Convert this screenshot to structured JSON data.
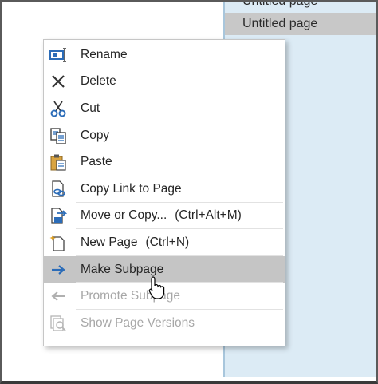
{
  "pages": {
    "items": [
      {
        "label": "Untitled page"
      },
      {
        "label": "Untitled page",
        "selected": true
      }
    ]
  },
  "context_menu": {
    "items": [
      {
        "label": "Rename",
        "icon": "rename-icon",
        "enabled": true
      },
      {
        "label": "Delete",
        "icon": "delete-icon",
        "enabled": true
      },
      {
        "label": "Cut",
        "icon": "scissors-icon",
        "enabled": true
      },
      {
        "label": "Copy",
        "icon": "copy-icon",
        "enabled": true
      },
      {
        "label": "Paste",
        "icon": "paste-icon",
        "enabled": true
      },
      {
        "label": "Copy Link to Page",
        "icon": "link-page-icon",
        "enabled": true
      },
      {
        "label": "Move or Copy...",
        "shortcut": "(Ctrl+Alt+M)",
        "icon": "move-copy-icon",
        "enabled": true
      },
      {
        "label": "New Page",
        "shortcut": "(Ctrl+N)",
        "icon": "new-page-icon",
        "enabled": true
      },
      {
        "label": "Make Subpage",
        "icon": "arrow-right-icon",
        "enabled": true,
        "hovered": true
      },
      {
        "label": "Promote Subpage",
        "icon": "arrow-left-icon",
        "enabled": false
      },
      {
        "label": "Show Page Versions",
        "icon": "page-versions-icon",
        "enabled": false
      }
    ]
  },
  "colors": {
    "accent_blue": "#2b6cb8",
    "page_pane_bg": "#dcebf5",
    "hover_bg": "#c5c5c5",
    "disabled_text": "#a7a7a7"
  }
}
